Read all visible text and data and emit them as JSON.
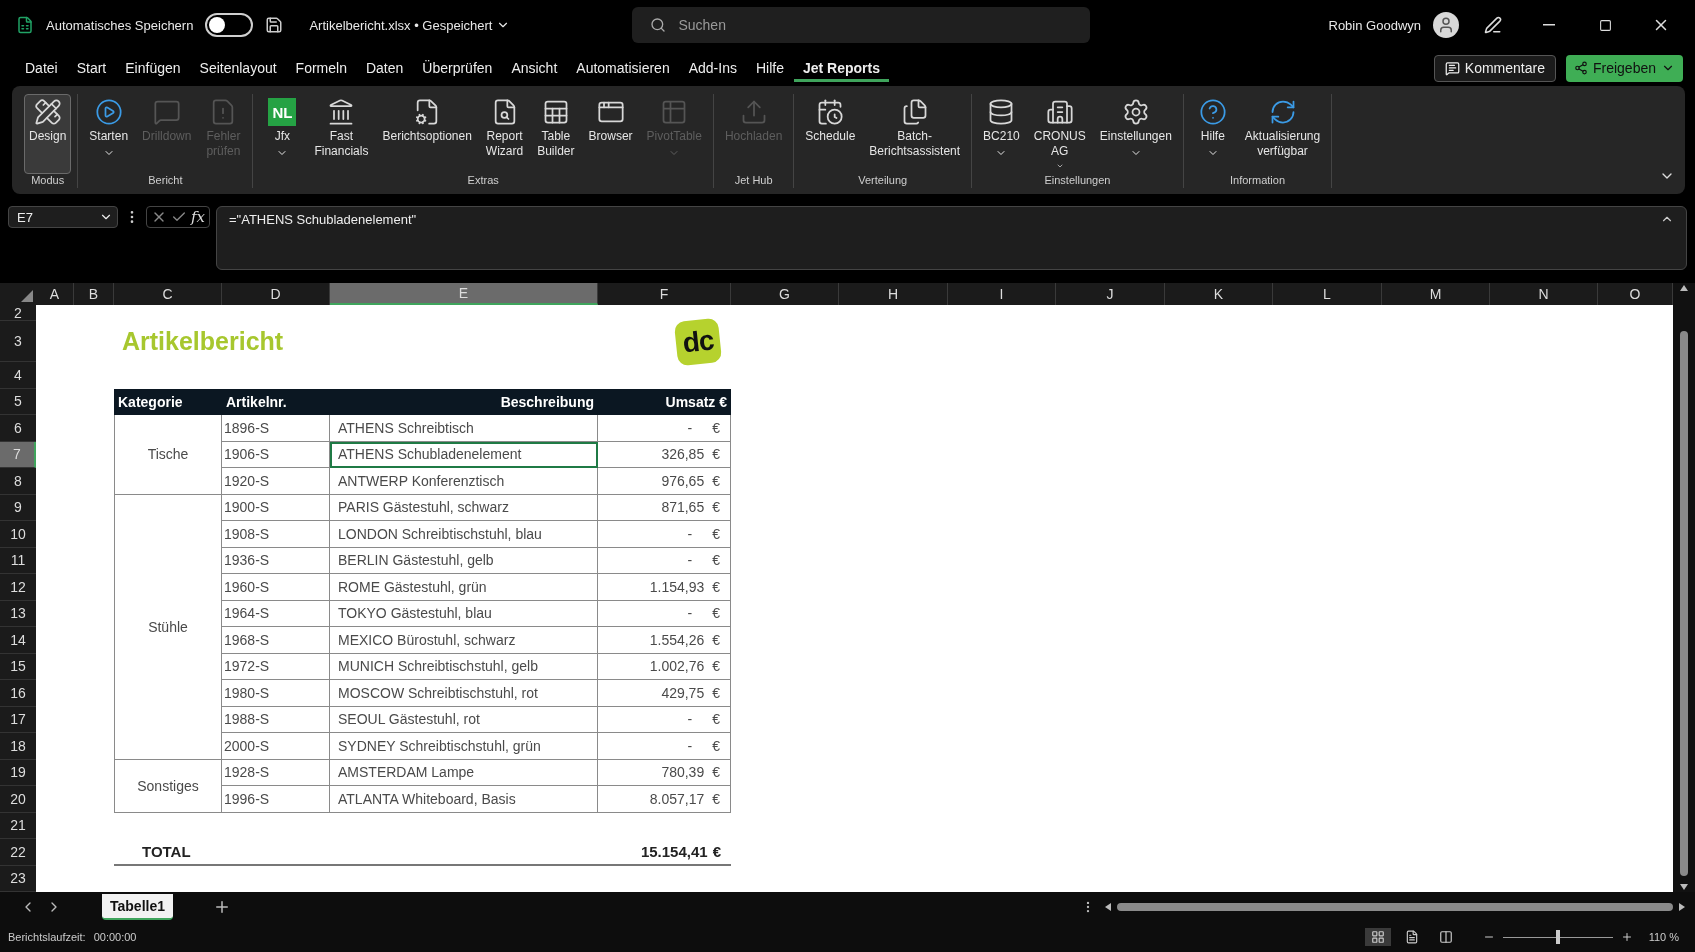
{
  "titlebar": {
    "autosave_label": "Automatisches Speichern",
    "autosave_on": false,
    "filename": "Artikelbericht.xlsx • Gespeichert",
    "search_placeholder": "Suchen",
    "user": "Robin Goodwyn"
  },
  "menu": [
    {
      "label": "Datei",
      "selected": false
    },
    {
      "label": "Start",
      "selected": false
    },
    {
      "label": "Einfügen",
      "selected": false
    },
    {
      "label": "Seitenlayout",
      "selected": false
    },
    {
      "label": "Formeln",
      "selected": false
    },
    {
      "label": "Daten",
      "selected": false
    },
    {
      "label": "Überprüfen",
      "selected": false
    },
    {
      "label": "Ansicht",
      "selected": false
    },
    {
      "label": "Automatisieren",
      "selected": false
    },
    {
      "label": "Add-Ins",
      "selected": false
    },
    {
      "label": "Hilfe",
      "selected": false
    },
    {
      "label": "Jet Reports",
      "selected": true
    }
  ],
  "actions": {
    "comments": "Kommentare",
    "share": "Freigeben"
  },
  "ribbon": {
    "groups": [
      {
        "label": "Modus",
        "buttons": [
          {
            "lines": [
              "Design"
            ],
            "selected": true,
            "disabled": false,
            "dropdown": false
          }
        ]
      },
      {
        "label": "Bericht",
        "buttons": [
          {
            "lines": [
              "Starten"
            ],
            "selected": false,
            "disabled": false,
            "dropdown": true
          },
          {
            "lines": [
              "Drilldown"
            ],
            "selected": false,
            "disabled": true,
            "dropdown": false
          },
          {
            "lines": [
              "Fehler",
              "prüfen"
            ],
            "selected": false,
            "disabled": true,
            "dropdown": false
          }
        ]
      },
      {
        "label": "Extras",
        "buttons": [
          {
            "lines": [
              "Jfx"
            ],
            "icon_text": "NL",
            "selected": false,
            "disabled": false,
            "dropdown": true
          },
          {
            "lines": [
              "Fast",
              "Financials"
            ],
            "selected": false,
            "disabled": false,
            "dropdown": false
          },
          {
            "lines": [
              "Berichtsoptionen"
            ],
            "selected": false,
            "disabled": false,
            "dropdown": false
          },
          {
            "lines": [
              "Report",
              "Wizard"
            ],
            "selected": false,
            "disabled": false,
            "dropdown": false
          },
          {
            "lines": [
              "Table",
              "Builder"
            ],
            "selected": false,
            "disabled": false,
            "dropdown": false
          },
          {
            "lines": [
              "Browser"
            ],
            "selected": false,
            "disabled": false,
            "dropdown": false
          },
          {
            "lines": [
              "PivotTable"
            ],
            "selected": false,
            "disabled": true,
            "dropdown": true
          }
        ]
      },
      {
        "label": "Jet Hub",
        "buttons": [
          {
            "lines": [
              "Hochladen"
            ],
            "selected": false,
            "disabled": true,
            "dropdown": false
          }
        ]
      },
      {
        "label": "Verteilung",
        "buttons": [
          {
            "lines": [
              "Schedule"
            ],
            "selected": false,
            "disabled": false,
            "dropdown": false
          },
          {
            "lines": [
              "Batch-",
              "Berichtsassistent"
            ],
            "selected": false,
            "disabled": false,
            "dropdown": false
          }
        ]
      },
      {
        "label": "Einstellungen",
        "buttons": [
          {
            "lines": [
              "BC210"
            ],
            "selected": false,
            "disabled": false,
            "dropdown": true
          },
          {
            "lines": [
              "CRONUS",
              "AG"
            ],
            "selected": false,
            "disabled": false,
            "dropdown": true
          },
          {
            "lines": [
              "Einstellungen"
            ],
            "selected": false,
            "disabled": false,
            "dropdown": true
          }
        ]
      },
      {
        "label": "Information",
        "buttons": [
          {
            "lines": [
              "Hilfe"
            ],
            "selected": false,
            "disabled": false,
            "dropdown": true
          },
          {
            "lines": [
              "Aktualisierung",
              "verfügbar"
            ],
            "selected": false,
            "disabled": false,
            "dropdown": false
          }
        ]
      }
    ]
  },
  "formula_bar": {
    "name_box": "E7",
    "function_label": "fx",
    "formula": "=\"ATHENS Schubladenelement\""
  },
  "columns": [
    {
      "label": "A",
      "selected": false
    },
    {
      "label": "B",
      "selected": false
    },
    {
      "label": "C",
      "selected": false
    },
    {
      "label": "D",
      "selected": false
    },
    {
      "label": "E",
      "selected": true
    },
    {
      "label": "F",
      "selected": false
    },
    {
      "label": "G",
      "selected": false
    },
    {
      "label": "H",
      "selected": false
    },
    {
      "label": "I",
      "selected": false
    },
    {
      "label": "J",
      "selected": false
    },
    {
      "label": "K",
      "selected": false
    },
    {
      "label": "L",
      "selected": false
    },
    {
      "label": "M",
      "selected": false
    },
    {
      "label": "N",
      "selected": false
    },
    {
      "label": "O",
      "selected": false
    }
  ],
  "rows": [
    {
      "label": "2",
      "selected": false
    },
    {
      "label": "3",
      "selected": false
    },
    {
      "label": "4",
      "selected": false
    },
    {
      "label": "5",
      "selected": false
    },
    {
      "label": "6",
      "selected": false
    },
    {
      "label": "7",
      "selected": true
    },
    {
      "label": "8",
      "selected": false
    },
    {
      "label": "9",
      "selected": false
    },
    {
      "label": "10",
      "selected": false
    },
    {
      "label": "11",
      "selected": false
    },
    {
      "label": "12",
      "selected": false
    },
    {
      "label": "13",
      "selected": false
    },
    {
      "label": "14",
      "selected": false
    },
    {
      "label": "15",
      "selected": false
    },
    {
      "label": "16",
      "selected": false
    },
    {
      "label": "17",
      "selected": false
    },
    {
      "label": "18",
      "selected": false
    },
    {
      "label": "19",
      "selected": false
    },
    {
      "label": "20",
      "selected": false
    },
    {
      "label": "21",
      "selected": false
    },
    {
      "label": "22",
      "selected": false
    },
    {
      "label": "23",
      "selected": false
    }
  ],
  "report": {
    "title": "Artikelbericht",
    "logo": "dc",
    "headers": [
      "Kategorie",
      "Artikelnr.",
      "Beschreibung",
      "Umsatz €"
    ],
    "groups": [
      {
        "category": "Tische",
        "items": [
          {
            "number": "1896-S",
            "description": "ATHENS Schreibtisch",
            "amount": "-",
            "currency": "€",
            "selected": false
          },
          {
            "number": "1906-S",
            "description": "ATHENS Schubladenelement",
            "amount": "326,85",
            "currency": "€",
            "selected": true
          },
          {
            "number": "1920-S",
            "description": "ANTWERP Konferenztisch",
            "amount": "976,65",
            "currency": "€",
            "selected": false
          }
        ]
      },
      {
        "category": "Stühle",
        "items": [
          {
            "number": "1900-S",
            "description": "PARIS Gästestuhl, schwarz",
            "amount": "871,65",
            "currency": "€",
            "selected": false
          },
          {
            "number": "1908-S",
            "description": "LONDON Schreibtischstuhl, blau",
            "amount": "-",
            "currency": "€",
            "selected": false
          },
          {
            "number": "1936-S",
            "description": "BERLIN Gästestuhl, gelb",
            "amount": "-",
            "currency": "€",
            "selected": false
          },
          {
            "number": "1960-S",
            "description": "ROME Gästestuhl, grün",
            "amount": "1.154,93",
            "currency": "€",
            "selected": false
          },
          {
            "number": "1964-S",
            "description": "TOKYO Gästestuhl, blau",
            "amount": "-",
            "currency": "€",
            "selected": false
          },
          {
            "number": "1968-S",
            "description": "MEXICO Bürostuhl, schwarz",
            "amount": "1.554,26",
            "currency": "€",
            "selected": false
          },
          {
            "number": "1972-S",
            "description": "MUNICH Schreibtischstuhl, gelb",
            "amount": "1.002,76",
            "currency": "€",
            "selected": false
          },
          {
            "number": "1980-S",
            "description": "MOSCOW Schreibtischstuhl, rot",
            "amount": "429,75",
            "currency": "€",
            "selected": false
          },
          {
            "number": "1988-S",
            "description": "SEOUL Gästestuhl, rot",
            "amount": "-",
            "currency": "€",
            "selected": false
          },
          {
            "number": "2000-S",
            "description": "SYDNEY Schreibtischstuhl, grün",
            "amount": "-",
            "currency": "€",
            "selected": false
          }
        ]
      },
      {
        "category": "Sonstiges",
        "items": [
          {
            "number": "1928-S",
            "description": "AMSTERDAM Lampe",
            "amount": "780,39",
            "currency": "€",
            "selected": false
          },
          {
            "number": "1996-S",
            "description": "ATLANTA Whiteboard, Basis",
            "amount": "8.057,17",
            "currency": "€",
            "selected": false
          }
        ]
      }
    ],
    "total": {
      "label": "TOTAL",
      "amount": "15.154,41",
      "currency": "€"
    }
  },
  "sheet_tabs": [
    {
      "label": "Tabelle1",
      "selected": true
    }
  ],
  "status_bar": {
    "label": "Berichtslaufzeit:",
    "value": "00:00:00",
    "views": [
      {
        "selected": true
      },
      {
        "selected": false
      },
      {
        "selected": false
      }
    ],
    "zoom": {
      "level": 0.5,
      "reading": "110 %"
    }
  }
}
